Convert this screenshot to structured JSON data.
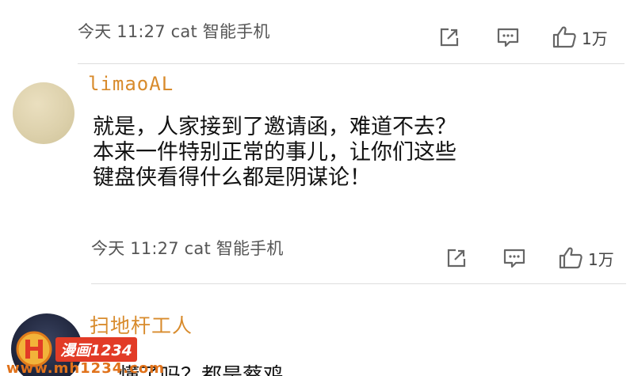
{
  "comment_top": {
    "meta": "今天 11:27 cat 智能手机",
    "like_count": "1万"
  },
  "comment_1": {
    "username": "limaoAL",
    "body": "就是，人家接到了邀请函，难道不去？\n本来一件特别正常的事儿，让你们这些\n键盘侠看得什么都是阴谋论！",
    "meta": "今天 11:27 cat 智能手机",
    "like_count": "1万"
  },
  "comment_2": {
    "username": "扫地杆工人",
    "body_partial": "   懂了吗？都是蔡鸡"
  },
  "watermark": {
    "badge": "漫画1234",
    "url": "www.mh1234.com"
  },
  "icons": {
    "share": "share-icon",
    "comment": "comment-icon",
    "like": "thumbs-up-icon"
  }
}
